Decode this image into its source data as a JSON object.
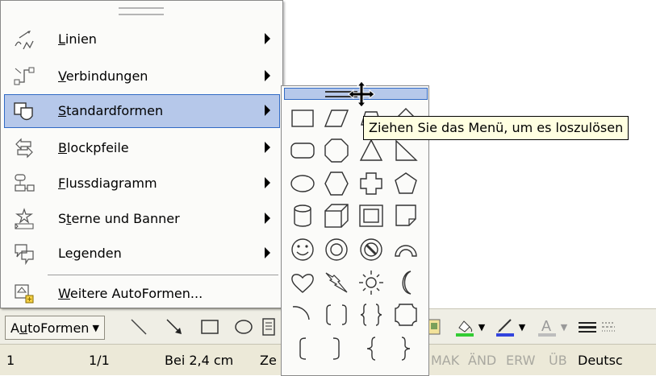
{
  "autoformen_menu": {
    "items": [
      {
        "label": "Linien",
        "accel": "L",
        "rest": "inien",
        "icon": "lines-icon",
        "has_submenu": true
      },
      {
        "label": "Verbindungen",
        "accel": "V",
        "rest": "erbindungen",
        "icon": "connectors-icon",
        "has_submenu": true
      },
      {
        "label": "Standardformen",
        "accel": "S",
        "rest": "tandardformen",
        "icon": "basic-shapes-icon",
        "has_submenu": true,
        "selected": true
      },
      {
        "label": "Blockpfeile",
        "accel": "B",
        "rest": "lockpfeile",
        "icon": "block-arrows-icon",
        "has_submenu": true
      },
      {
        "label": "Flussdiagramm",
        "accel": "F",
        "rest": "lussdiagramm",
        "icon": "flowchart-icon",
        "has_submenu": true
      },
      {
        "label": "Sterne und Banner",
        "pre": "S",
        "accel": "t",
        "rest": "erne und Banner",
        "icon": "stars-banners-icon",
        "has_submenu": true
      },
      {
        "label": "Legenden",
        "pre": "Le",
        "accel": "g",
        "rest": "enden",
        "icon": "callouts-icon",
        "has_submenu": true
      },
      {
        "label": "Weitere AutoFormen...",
        "accel": "W",
        "rest": "eitere AutoFormen...",
        "icon": "more-autoshapes-icon",
        "has_submenu": false
      }
    ]
  },
  "shapes_menu": {
    "shapes": [
      "rectangle",
      "parallelogram",
      "trapezoid",
      "diamond",
      "rounded-rectangle",
      "octagon",
      "isosceles-triangle",
      "right-triangle",
      "oval",
      "hexagon",
      "cross",
      "pentagon",
      "can",
      "cube",
      "bevel",
      "folded-corner",
      "smiley-face",
      "donut",
      "no-symbol",
      "block-arc",
      "heart",
      "lightning-bolt",
      "sun",
      "moon",
      "arc",
      "double-bracket",
      "double-brace",
      "plaque",
      "left-bracket",
      "right-bracket",
      "left-brace",
      "right-brace"
    ]
  },
  "tooltip": {
    "text": "Ziehen Sie das Menü, um es loszulösen"
  },
  "toolbar": {
    "autoformen_pre": "A",
    "autoformen_accel": "u",
    "autoformen_rest": "toFormen"
  },
  "status_bar": {
    "page": "1",
    "pages": "1/1",
    "position": "Bei 2,4 cm",
    "line_prefix": "Ze",
    "mak": "MAK",
    "aend": "ÄND",
    "erw": "ERW",
    "ueb": "ÜB",
    "language": "Deutsc"
  },
  "colors": {
    "highlight": "#b6c8ea",
    "highlight_border": "#316ac5",
    "tooltip_bg": "#ffffe1",
    "menu_bg": "#fbfbf9"
  }
}
